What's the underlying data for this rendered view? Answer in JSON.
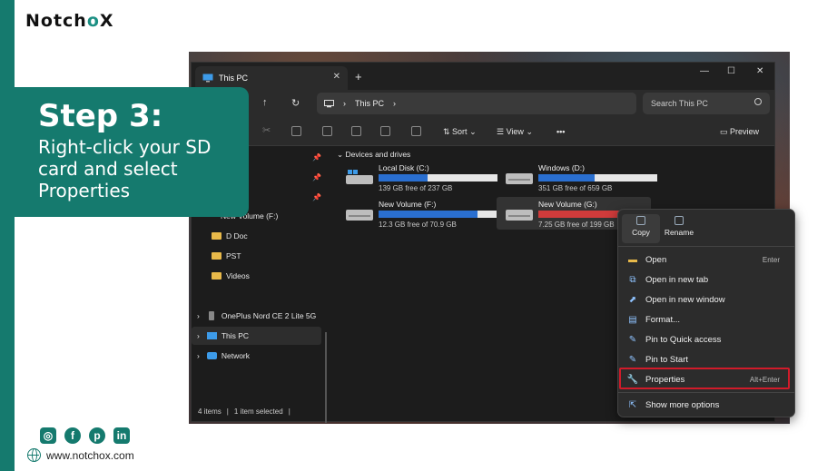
{
  "brand": {
    "logo_pre": "Notch",
    "logo_o": "o",
    "logo_x": "X"
  },
  "step": {
    "title": "Step 3:",
    "text": "Right-click your SD card and select Properties"
  },
  "footer": {
    "website": "www.notchox.com"
  },
  "explorer": {
    "tab_title": "This PC",
    "address": "This PC",
    "search_placeholder": "Search This PC",
    "toolbar": {
      "sort": "Sort",
      "view": "View",
      "more": "•••",
      "preview": "Preview"
    },
    "nav": [
      {
        "label": "New Volume (F:)",
        "type": "drive"
      },
      {
        "label": "D Doc",
        "type": "folder"
      },
      {
        "label": "PST",
        "type": "folder"
      },
      {
        "label": "Videos",
        "type": "folder"
      },
      {
        "label": "OnePlus Nord CE 2 Lite 5G",
        "type": "device"
      },
      {
        "label": "This PC",
        "type": "pc"
      },
      {
        "label": "Network",
        "type": "network"
      }
    ],
    "group_label": "Devices and drives",
    "drives": [
      {
        "name": "Local Disk (C:)",
        "free": "139 GB free of 237 GB",
        "used_fraction": 0.41
      },
      {
        "name": "Windows (D:)",
        "free": "351 GB free of 659 GB",
        "used_fraction": 0.47
      },
      {
        "name": "New Volume (F:)",
        "free": "12.3 GB free of 70.9 GB",
        "used_fraction": 0.83
      },
      {
        "name": "New Volume (G:)",
        "free": "7.25 GB free of 199 GB",
        "used_fraction": 0.96
      }
    ],
    "status": {
      "items": "4 items",
      "selected": "1 item selected"
    }
  },
  "context_menu": {
    "top": {
      "copy": "Copy",
      "rename": "Rename"
    },
    "items": [
      {
        "label": "Open",
        "key": "Enter"
      },
      {
        "label": "Open in new tab",
        "key": ""
      },
      {
        "label": "Open in new window",
        "key": ""
      },
      {
        "label": "Format...",
        "key": ""
      },
      {
        "label": "Pin to Quick access",
        "key": ""
      },
      {
        "label": "Pin to Start",
        "key": ""
      },
      {
        "label": "Properties",
        "key": "Alt+Enter"
      },
      {
        "label": "Show more options",
        "key": ""
      }
    ]
  },
  "colors": {
    "teal": "#157a6e",
    "highlight": "#d11b2a",
    "bar_blue": "#2a6fd0",
    "bar_red": "#d13b3b"
  }
}
